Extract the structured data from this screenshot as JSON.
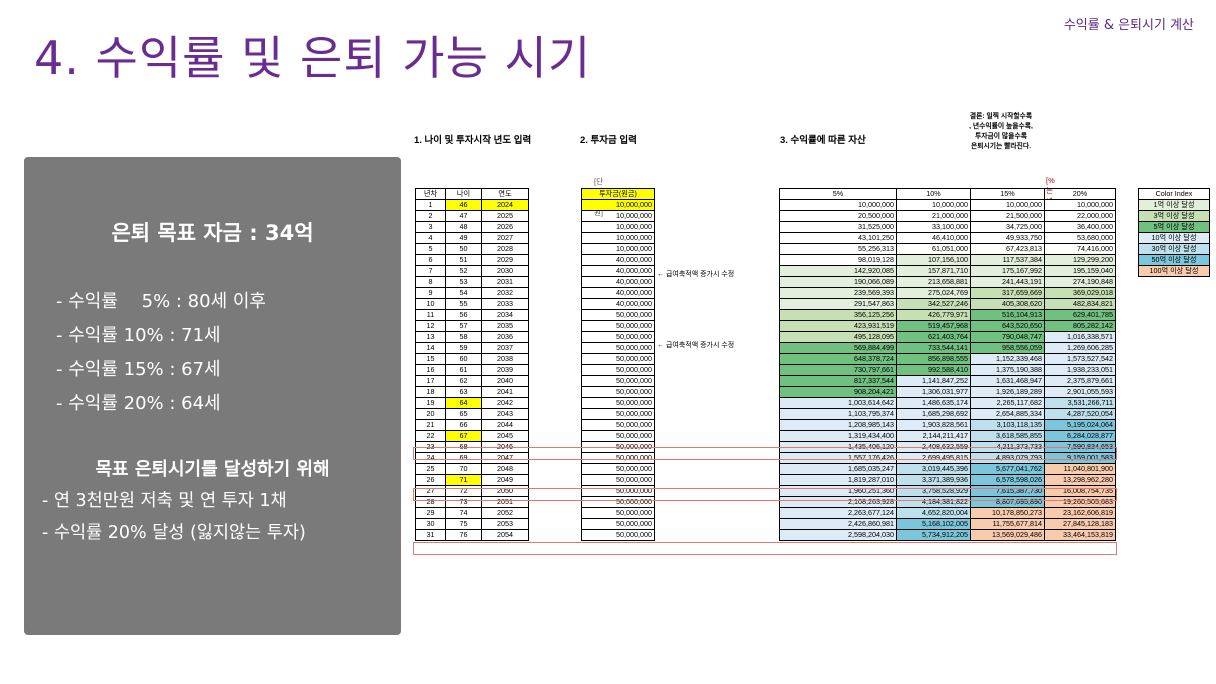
{
  "header": {
    "top_right": "수익률 & 은퇴시기 계산",
    "title": "4. 수익률 및 은퇴 가능 시기"
  },
  "panel": {
    "goal": "은퇴 목표 자금 : 34억",
    "rates": [
      "- 수익률 　5% : 80세 이후",
      "- 수익률 10% : 71세",
      "- 수익률 15% : 67세",
      "- 수익률 20% : 64세"
    ],
    "subtitle": "목표 은퇴시기를 달성하기 위해",
    "notes": [
      "- 연 3천만원 저축 및 연 투자 1채",
      "- 수익률 20% 달성 (잃지않는 투자)"
    ]
  },
  "sheet": {
    "section1": "1. 나이 및 투자시작 년도 입력",
    "section2": "2. 투자금 입력",
    "section3": "3. 수익률에 따른 자산",
    "conclusion": [
      "결론: 일찍 시작할수록",
      ", 년수익률이 높을수록,",
      "투자금이 많을수록",
      "은퇴시기는 빨라진다."
    ],
    "unit_label": "[단위 : 원]",
    "pct_label": "[%는 년 수익률]",
    "col_headers": {
      "year_no": "년차",
      "age": "나이",
      "year": "연도",
      "invest": "투자금(원금)",
      "r5": "5%",
      "r10": "10%",
      "r15": "15%",
      "r20": "20%"
    },
    "notes": {
      "row6": "← 급여축적액 증가시 수정",
      "row11": "← 급여축적액 증가시 수정"
    },
    "rows": [
      [
        "1",
        "46",
        "2024",
        "10,000,000",
        "10,000,000",
        "10,000,000",
        "10,000,000",
        "10,000,000"
      ],
      [
        "2",
        "47",
        "2025",
        "10,000,000",
        "20,500,000",
        "21,000,000",
        "21,500,000",
        "22,000,000"
      ],
      [
        "3",
        "48",
        "2026",
        "10,000,000",
        "31,525,000",
        "33,100,000",
        "34,725,000",
        "36,400,000"
      ],
      [
        "4",
        "49",
        "2027",
        "10,000,000",
        "43,101,250",
        "46,410,000",
        "49,933,750",
        "53,680,000"
      ],
      [
        "5",
        "50",
        "2028",
        "10,000,000",
        "55,256,313",
        "61,051,000",
        "67,423,813",
        "74,416,000"
      ],
      [
        "6",
        "51",
        "2029",
        "40,000,000",
        "98,019,128",
        "107,156,100",
        "117,537,384",
        "129,299,200"
      ],
      [
        "7",
        "52",
        "2030",
        "40,000,000",
        "142,920,085",
        "157,871,710",
        "175,167,992",
        "195,159,040"
      ],
      [
        "8",
        "53",
        "2031",
        "40,000,000",
        "190,066,089",
        "213,658,881",
        "241,443,191",
        "274,190,848"
      ],
      [
        "9",
        "54",
        "2032",
        "40,000,000",
        "239,569,393",
        "275,024,769",
        "317,659,669",
        "369,029,018"
      ],
      [
        "10",
        "55",
        "2033",
        "40,000,000",
        "291,547,863",
        "342,527,246",
        "405,308,620",
        "482,834,821"
      ],
      [
        "11",
        "56",
        "2034",
        "50,000,000",
        "356,125,256",
        "426,779,971",
        "516,104,913",
        "629,401,785"
      ],
      [
        "12",
        "57",
        "2035",
        "50,000,000",
        "423,931,519",
        "519,457,968",
        "643,520,650",
        "805,282,142"
      ],
      [
        "13",
        "58",
        "2036",
        "50,000,000",
        "495,128,095",
        "621,403,764",
        "790,048,747",
        "1,016,338,571"
      ],
      [
        "14",
        "59",
        "2037",
        "50,000,000",
        "569,884,499",
        "733,544,141",
        "958,556,059",
        "1,269,606,285"
      ],
      [
        "15",
        "60",
        "2038",
        "50,000,000",
        "648,378,724",
        "856,898,555",
        "1,152,339,468",
        "1,573,527,542"
      ],
      [
        "16",
        "61",
        "2039",
        "50,000,000",
        "730,797,661",
        "992,588,410",
        "1,375,190,388",
        "1,938,233,051"
      ],
      [
        "17",
        "62",
        "2040",
        "50,000,000",
        "817,337,544",
        "1,141,847,252",
        "1,631,468,947",
        "2,375,879,661"
      ],
      [
        "18",
        "63",
        "2041",
        "50,000,000",
        "908,204,421",
        "1,306,031,977",
        "1,926,189,289",
        "2,901,055,593"
      ],
      [
        "19",
        "64",
        "2042",
        "50,000,000",
        "1,003,614,642",
        "1,486,635,174",
        "2,265,117,682",
        "3,531,266,711"
      ],
      [
        "20",
        "65",
        "2043",
        "50,000,000",
        "1,103,795,374",
        "1,685,298,692",
        "2,654,885,334",
        "4,287,520,054"
      ],
      [
        "21",
        "66",
        "2044",
        "50,000,000",
        "1,208,985,143",
        "1,903,828,561",
        "3,103,118,135",
        "5,195,024,064"
      ],
      [
        "22",
        "67",
        "2045",
        "50,000,000",
        "1,319,434,400",
        "2,144,211,417",
        "3,618,585,855",
        "6,284,028,877"
      ],
      [
        "23",
        "68",
        "2046",
        "50,000,000",
        "1,435,406,120",
        "2,408,632,559",
        "4,211,373,733",
        "7,590,834,653"
      ],
      [
        "24",
        "69",
        "2047",
        "50,000,000",
        "1,557,176,426",
        "2,699,495,815",
        "4,893,079,793",
        "9,159,001,583"
      ],
      [
        "25",
        "70",
        "2048",
        "50,000,000",
        "1,685,035,247",
        "3,019,445,396",
        "5,677,041,762",
        "11,040,801,900"
      ],
      [
        "26",
        "71",
        "2049",
        "50,000,000",
        "1,819,287,010",
        "3,371,389,936",
        "6,578,598,026",
        "13,298,962,280"
      ],
      [
        "27",
        "72",
        "2050",
        "50,000,000",
        "1,960,251,360",
        "3,758,528,929",
        "7,615,387,730",
        "16,008,754,735"
      ],
      [
        "28",
        "73",
        "2051",
        "50,000,000",
        "2,108,263,928",
        "4,184,381,822",
        "8,807,695,890",
        "19,260,505,683"
      ],
      [
        "29",
        "74",
        "2052",
        "50,000,000",
        "2,263,677,124",
        "4,652,820,004",
        "10,178,850,273",
        "23,162,606,819"
      ],
      [
        "30",
        "75",
        "2053",
        "50,000,000",
        "2,426,860,981",
        "5,168,102,005",
        "11,755,677,814",
        "27,845,128,183"
      ],
      [
        "31",
        "76",
        "2054",
        "50,000,000",
        "2,598,204,030",
        "5,734,912,205",
        "13,569,029,486",
        "33,464,153,819"
      ]
    ],
    "highlight_ages": [
      "46",
      "64",
      "67",
      "71"
    ],
    "color_index": {
      "title": "Color Index",
      "items": [
        {
          "label": "1억 이상 달성",
          "color": "#e2efda"
        },
        {
          "label": "3억 이상 달성",
          "color": "#c6e0b4"
        },
        {
          "label": "5억 이상 달성",
          "color": "#70c080"
        },
        {
          "label": "10억 이상 달성",
          "color": "#ddebf7"
        },
        {
          "label": "30억 이상 달성",
          "color": "#bde0ec"
        },
        {
          "label": "50억 이상 달성",
          "color": "#7cc6dc"
        },
        {
          "label": "100억 이상 달성",
          "color": "#f8cbad"
        }
      ]
    }
  }
}
